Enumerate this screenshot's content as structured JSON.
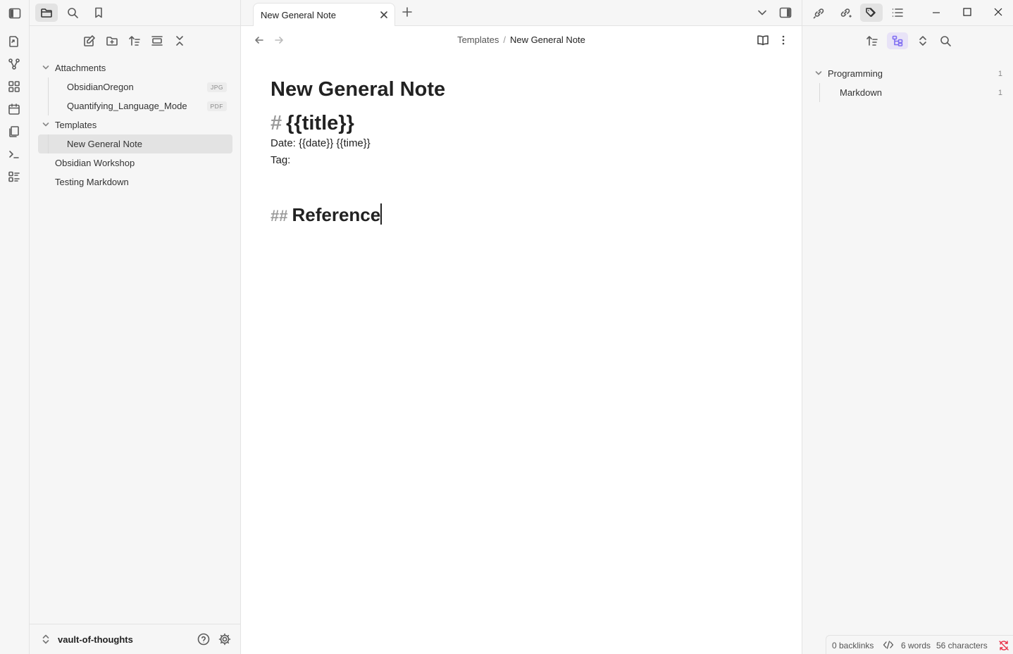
{
  "left_sidebar": {
    "tree": [
      {
        "type": "folder",
        "name": "Attachments"
      },
      {
        "type": "file",
        "name": "ObsidianOregon",
        "ext": "JPG"
      },
      {
        "type": "file",
        "name": "Quantifying_Language_Mode",
        "ext": "PDF"
      },
      {
        "type": "folder",
        "name": "Templates"
      },
      {
        "type": "file",
        "name": "New General Note",
        "selected": true
      },
      {
        "type": "rootfile",
        "name": "Obsidian Workshop"
      },
      {
        "type": "rootfile",
        "name": "Testing Markdown"
      }
    ],
    "vault_name": "vault-of-thoughts"
  },
  "main": {
    "tab_title": "New General Note",
    "breadcrumb": {
      "folder": "Templates",
      "separator": "/",
      "current": "New General Note"
    },
    "editor": {
      "inline_title": "New General Note",
      "h1_hash": "#",
      "h1_text": "{{title}}",
      "date_line": "Date: {{date}} {{time}}",
      "tag_line": "Tag:",
      "h2_hash": "##",
      "h2_text": "Reference"
    }
  },
  "right_sidebar": {
    "tags": [
      {
        "name": "Programming",
        "count": "1"
      },
      {
        "name": "Markdown",
        "count": "1"
      }
    ]
  },
  "status_bar": {
    "backlinks": "0 backlinks",
    "words": "6 words",
    "characters": "56 characters"
  },
  "colors": {
    "accent": "#7f6df2",
    "sync_off": "#e93147",
    "sidebar_bg": "#f6f6f6"
  }
}
